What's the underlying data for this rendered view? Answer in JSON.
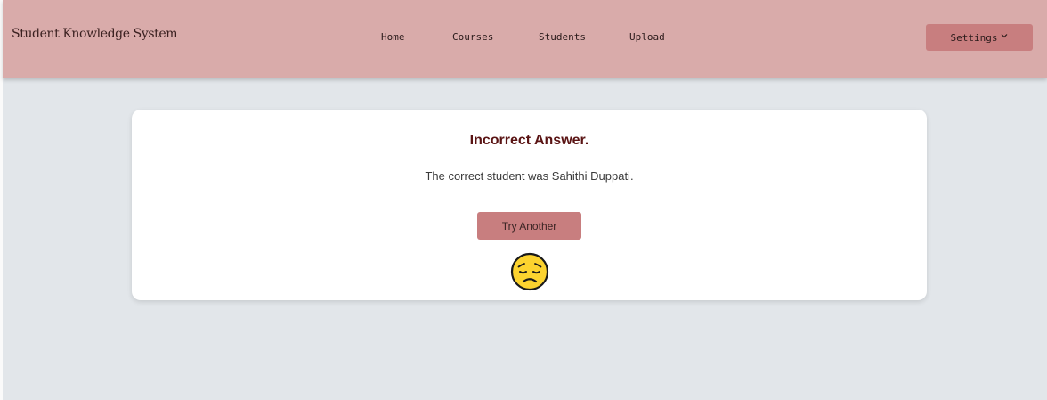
{
  "navbar": {
    "brand": "Student Knowledge System",
    "links": [
      {
        "label": "Home"
      },
      {
        "label": "Courses"
      },
      {
        "label": "Students"
      },
      {
        "label": "Upload"
      }
    ],
    "settings_label": "Settings",
    "settings_icon": "chevron-down-icon"
  },
  "result": {
    "title": "Incorrect Answer.",
    "message": "The correct student was Sahithi Duppati.",
    "try_label": "Try Another",
    "emoji_icon": "sad-face-icon"
  },
  "colors": {
    "navbar_bg": "#d9abaa",
    "accent": "#c87e7f",
    "page_bg": "#e2e6ea",
    "title": "#5a1414",
    "emoji_fill": "#fcd32f"
  }
}
